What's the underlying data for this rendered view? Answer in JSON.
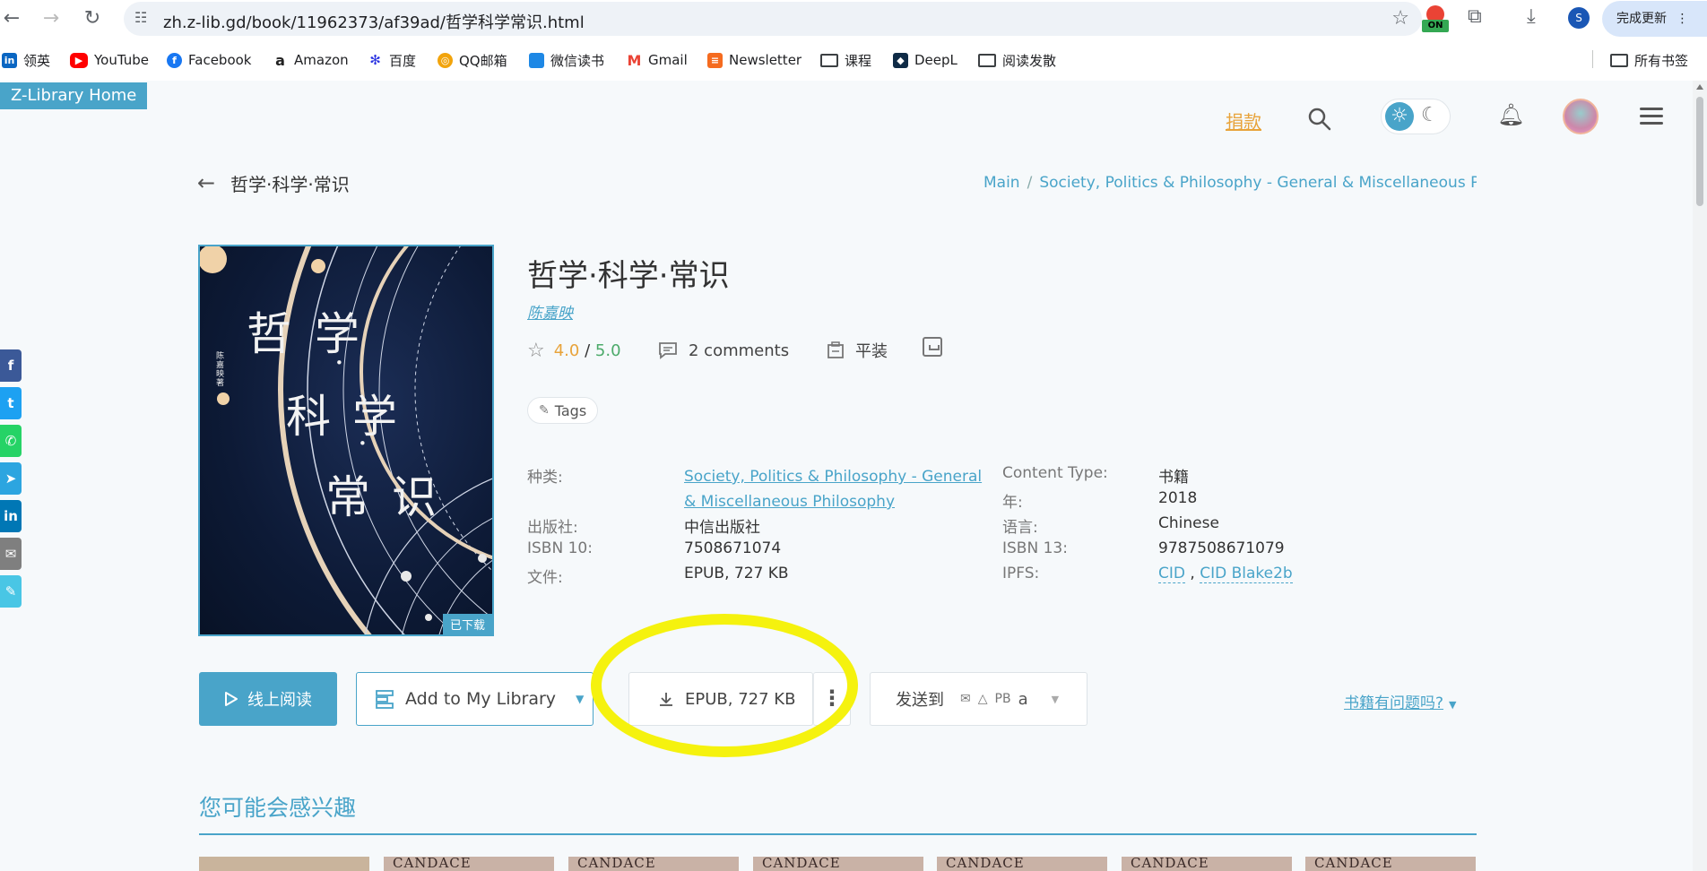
{
  "browser": {
    "url": "zh.z-lib.gd/book/11962373/af39ad/哲学科学常识.html",
    "extension_badge": "ON",
    "profile_initial": "S",
    "update_label": "完成更新"
  },
  "bookmarks": [
    {
      "label": "领英",
      "icon": "linkedin-icon",
      "color": "#0a66c2"
    },
    {
      "label": "YouTube",
      "icon": "youtube-icon",
      "color": "#ff0000"
    },
    {
      "label": "Facebook",
      "icon": "facebook-icon",
      "color": "#1877f2"
    },
    {
      "label": "Amazon",
      "icon": "amazon-icon",
      "color": "#222222"
    },
    {
      "label": "百度",
      "icon": "baidu-icon",
      "color": "#2932e1"
    },
    {
      "label": "QQ邮箱",
      "icon": "qq-mail-icon",
      "color": "#f2a40c"
    },
    {
      "label": "微信读书",
      "icon": "weread-icon",
      "color": "#1e88e5"
    },
    {
      "label": "Gmail",
      "icon": "gmail-icon",
      "color": "#ea4335"
    },
    {
      "label": "Newsletter",
      "icon": "newsletter-icon",
      "color": "#f56b1f"
    },
    {
      "label": "课程",
      "icon": "folder-icon",
      "color": "#3c4043"
    },
    {
      "label": "DeepL",
      "icon": "deepl-icon",
      "color": "#0f2b46"
    },
    {
      "label": "阅读发散",
      "icon": "folder-icon",
      "color": "#3c4043"
    }
  ],
  "all_bookmarks_label": "所有书签",
  "site": {
    "home_label": "Z-Library Home",
    "donate_label": "捐款",
    "accent_color": "#49a4c9"
  },
  "book": {
    "title_top": "哲学·科学·常识",
    "breadcrumb_main": "Main",
    "breadcrumb_category": "Society, Politics & Philosophy - General & Miscellaneous P",
    "title": "哲学·科学·常识",
    "author": "陈嘉映",
    "rating": "4.0",
    "rating_sep": " / ",
    "rating_max": "5.0",
    "comments": "2 comments",
    "binding": "平装",
    "tags_label": "Tags",
    "cover_badge": "已下载",
    "cover_chars": [
      "哲",
      "学",
      "·",
      "科",
      "学",
      "·",
      "常",
      "识"
    ],
    "cover_author_vertical": "陈嘉映著"
  },
  "properties": {
    "category_label": "种类:",
    "category_value": "Society, Politics & Philosophy - General & Miscellaneous Philosophy",
    "category_line1": "Society, Politics & Philosophy - General",
    "category_line2": "& Miscellaneous Philosophy",
    "content_type_label": "Content Type:",
    "content_type_value": "书籍",
    "year_label": "年:",
    "year_value": "2018",
    "publisher_label": "出版社:",
    "publisher_value": "中信出版社",
    "language_label": "语言:",
    "language_value": "Chinese",
    "isbn10_label": "ISBN 10:",
    "isbn10_value": "7508671074",
    "isbn13_label": "ISBN 13:",
    "isbn13_value": "9787508671079",
    "file_label": "文件:",
    "file_value": "EPUB, 727 KB",
    "ipfs_label": "IPFS:",
    "ipfs_cid": "CID",
    "ipfs_sep": " , ",
    "ipfs_blake": "CID Blake2b"
  },
  "actions": {
    "read_online": "线上阅读",
    "add_library": "Add to My Library",
    "download": "EPUB, 727 KB",
    "send_to": "发送到",
    "send_pb": "PB",
    "report": "书籍有问题吗?"
  },
  "recommendations": {
    "title": "您可能会感兴趣",
    "thumb_text": "CANDACE WONDRAK"
  }
}
